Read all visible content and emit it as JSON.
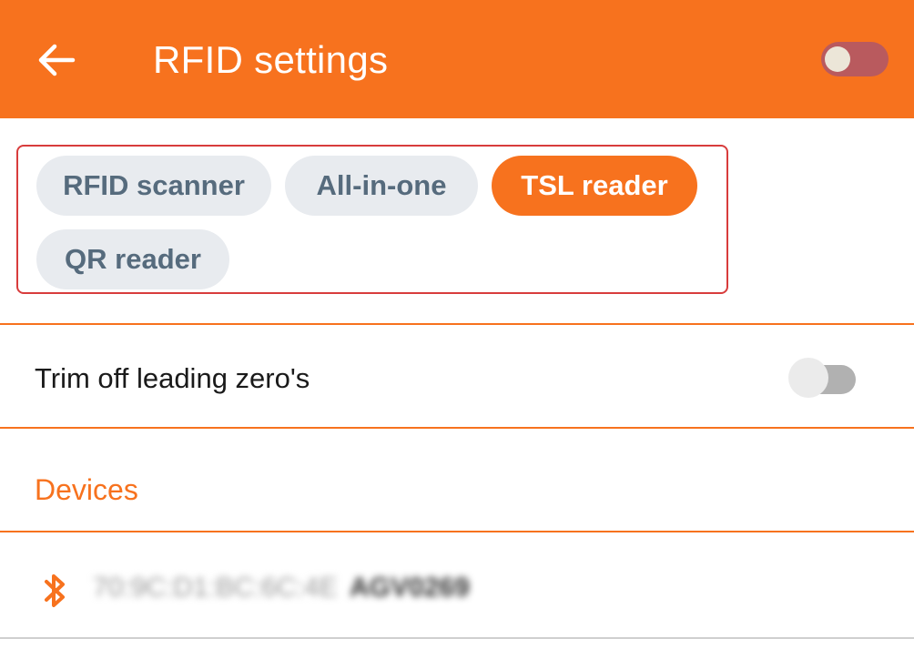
{
  "app_bar": {
    "title": "RFID settings",
    "back_icon": "arrow-left-icon",
    "toggle_enabled": true
  },
  "scanner_types": {
    "options": [
      {
        "label": "RFID scanner",
        "selected": false
      },
      {
        "label": "All-in-one",
        "selected": false
      },
      {
        "label": "TSL reader",
        "selected": true
      },
      {
        "label": "QR reader",
        "selected": false
      }
    ]
  },
  "settings": {
    "trim_leading_zeros": {
      "label": "Trim off leading zero's",
      "enabled": false
    }
  },
  "devices": {
    "header": "Devices",
    "items": [
      {
        "icon": "bluetooth-icon",
        "mac": "70:9C:D1:BC:6C:4E",
        "name": "AGV0269"
      }
    ]
  },
  "colors": {
    "accent": "#F7721E",
    "chip_bg": "#E8EBEF",
    "chip_text": "#566B7D",
    "highlight_border": "#D83C3C"
  }
}
